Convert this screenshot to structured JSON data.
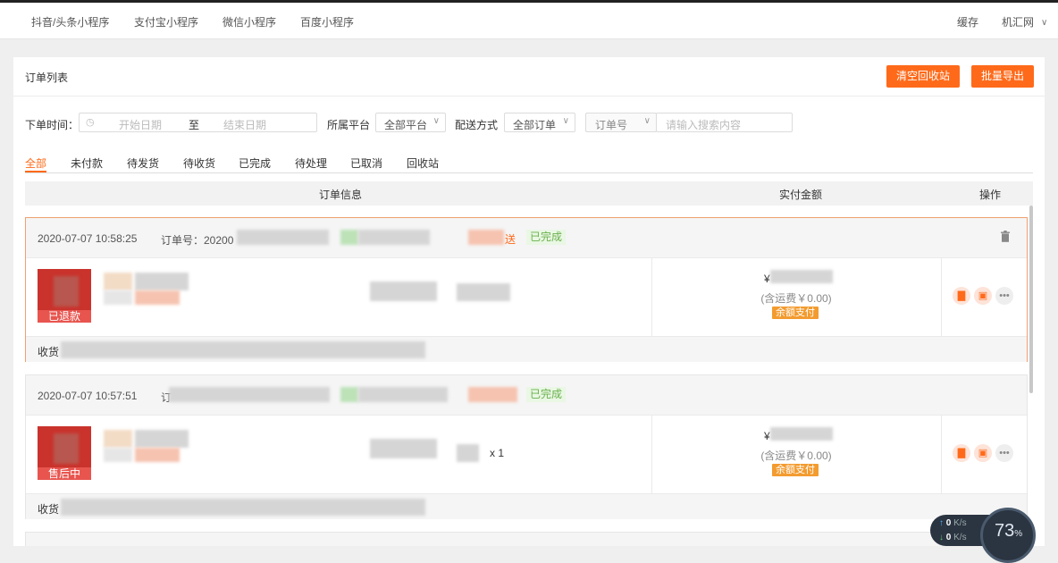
{
  "topnav": {
    "items": [
      "抖音/头条小程序",
      "支付宝小程序",
      "微信小程序",
      "百度小程序"
    ],
    "cache": "缓存",
    "site": "机汇网"
  },
  "page": {
    "title": "订单列表",
    "btn_clear": "清空回收站",
    "btn_export": "批量导出"
  },
  "filters": {
    "time_label": "下单时间：",
    "start_placeholder": "开始日期",
    "to": "至",
    "end_placeholder": "结束日期",
    "platform_label": "所属平台",
    "platform_value": "全部平台",
    "delivery_label": "配送方式",
    "delivery_value": "全部订单",
    "search_type": "订单号",
    "search_placeholder": "请输入搜索内容"
  },
  "tabs": [
    "全部",
    "未付款",
    "待发货",
    "待收货",
    "已完成",
    "待处理",
    "已取消",
    "回收站"
  ],
  "table_headers": {
    "info": "订单信息",
    "amount": "实付金额",
    "ops": "操作"
  },
  "orders": [
    {
      "date": "2020-07-07 10:58:25",
      "order_no": "订单号：20200",
      "delivery_tail": "送",
      "status": "已完成",
      "thumb_tag": "已退款",
      "amount_prefix": "¥",
      "shipping": "(含运费￥0.00)",
      "pay": "余额支付",
      "consignee_label": "收货"
    },
    {
      "date": "2020-07-07 10:57:51",
      "order_no": "订",
      "status": "已完成",
      "thumb_tag": "售后中",
      "qty": "x 1",
      "amount_prefix": "¥",
      "shipping": "(含运费￥0.00)",
      "pay": "余额支付",
      "consignee_label": "收货"
    }
  ],
  "speed_widget": {
    "up": "0",
    "down": "0",
    "unit": "K/s",
    "percent": "73",
    "percent_unit": "%"
  },
  "colors": {
    "accent": "#ff6a1a",
    "done": "#6ab04c",
    "pay": "#f39b2f"
  }
}
